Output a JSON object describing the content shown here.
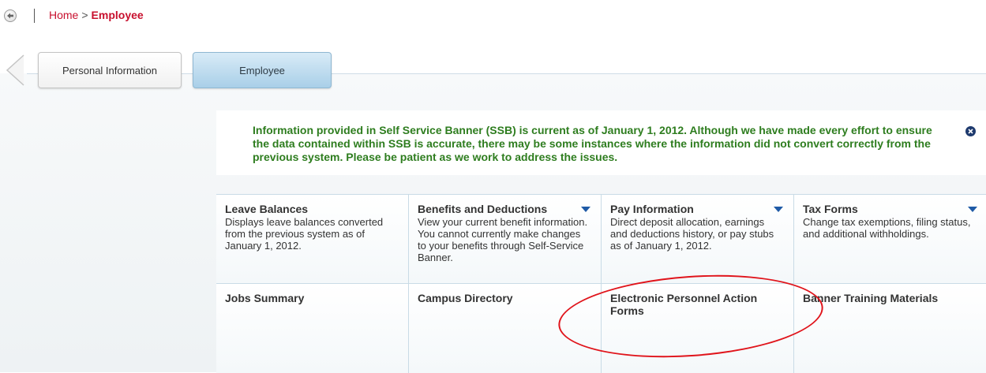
{
  "breadcrumb": {
    "home": "Home",
    "separator": ">",
    "current": "Employee"
  },
  "tabs": [
    {
      "label": "Personal Information",
      "active": false
    },
    {
      "label": "Employee",
      "active": true
    }
  ],
  "notice": {
    "text": "Information provided in Self Service Banner (SSB) is current as of January 1, 2012. Although we have made every effort to ensure the data contained within SSB is accurate, there may be some instances where the information did not convert correctly from the previous system. Please be patient as we work to address the issues."
  },
  "grid": {
    "row1": [
      {
        "title": "Leave Balances",
        "desc": "Displays leave balances converted from the previous system as of January 1, 2012.",
        "dropdown": false
      },
      {
        "title": "Benefits and Deductions",
        "desc": "View your current benefit information. You cannot currently make changes to your benefits through Self-Service Banner.",
        "dropdown": true
      },
      {
        "title": "Pay Information",
        "desc": "Direct deposit allocation, earnings and deductions history, or pay stubs as of January 1, 2012.",
        "dropdown": true
      },
      {
        "title": "Tax Forms",
        "desc": "Change tax exemptions, filing status, and additional withholdings.",
        "dropdown": true
      }
    ],
    "row2": [
      {
        "title": "Jobs Summary"
      },
      {
        "title": "Campus Directory"
      },
      {
        "title": "Electronic Personnel Action Forms"
      },
      {
        "title": "Banner Training Materials"
      }
    ]
  },
  "colors": {
    "accent_red": "#c8102e",
    "notice_green": "#2e7d1f",
    "dropdown_blue": "#1f5aa6",
    "annotation_red": "#e0141b"
  },
  "icons": {
    "back": "back-arrow-icon",
    "close": "close-icon",
    "dropdown": "triangle-down-icon"
  }
}
